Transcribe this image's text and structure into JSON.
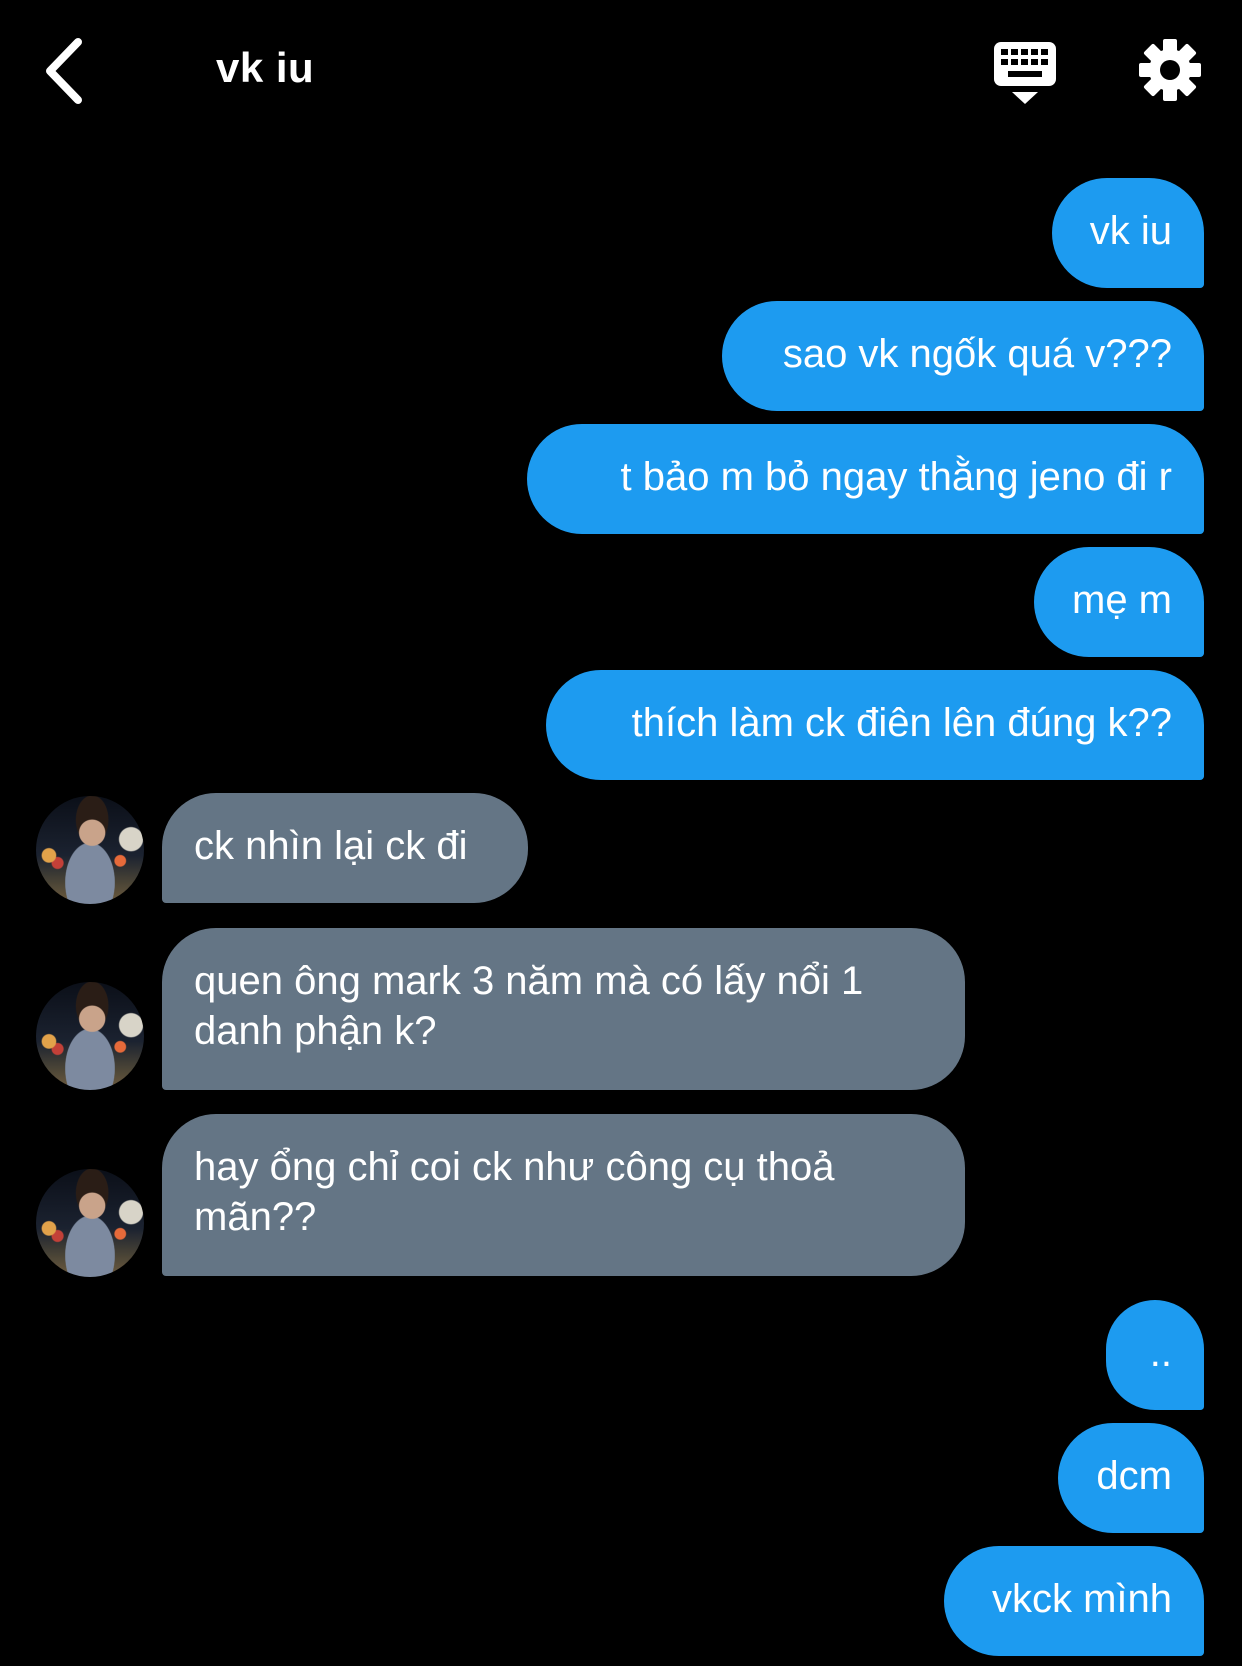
{
  "header": {
    "title": "vk iu",
    "back_icon": "chevron-left-icon",
    "keyboard_icon": "keyboard-hide-icon",
    "settings_icon": "gear-icon"
  },
  "colors": {
    "background": "#000000",
    "outgoing_bubble": "#1d9bf0",
    "incoming_bubble": "#647585"
  },
  "messages": [
    {
      "direction": "outgoing",
      "text": "vk iu"
    },
    {
      "direction": "outgoing",
      "text": "sao vk ngốk quá v???"
    },
    {
      "direction": "outgoing",
      "text": "t bảo m bỏ ngay thằng jeno đi r"
    },
    {
      "direction": "outgoing",
      "text": "mẹ m"
    },
    {
      "direction": "outgoing",
      "text": "thích làm ck điên lên đúng k??"
    },
    {
      "direction": "incoming",
      "text": "ck nhìn lại ck đi"
    },
    {
      "direction": "incoming",
      "text": "quen ông mark 3 năm mà có lấy nổi 1\ndanh phận k?"
    },
    {
      "direction": "incoming",
      "text": "hay ổng chỉ coi ck như công cụ thoả\nmãn??"
    },
    {
      "direction": "outgoing",
      "text": ".."
    },
    {
      "direction": "outgoing",
      "text": "dcm"
    },
    {
      "direction": "outgoing",
      "text": "vkck mình"
    }
  ]
}
